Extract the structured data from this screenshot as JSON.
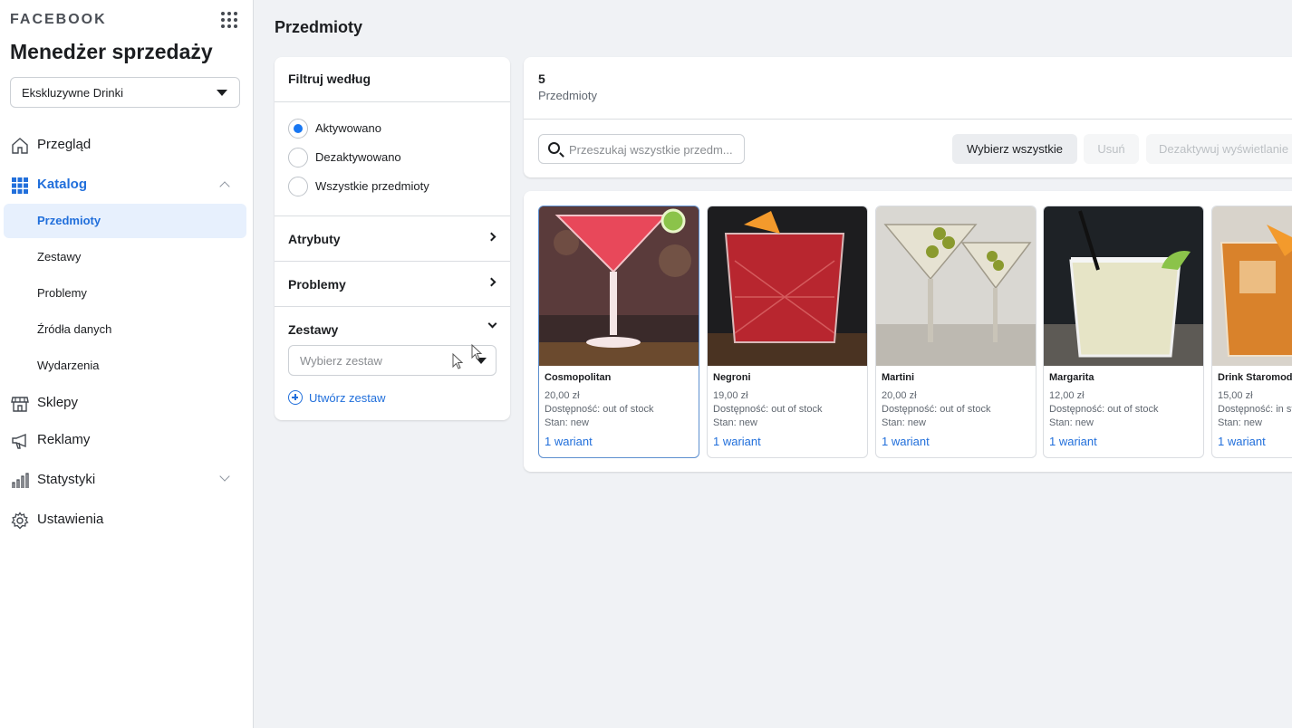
{
  "sidebar": {
    "brand": "FACEBOOK",
    "app_title": "Menedżer sprzedaży",
    "account": "Ekskluzywne Drinki",
    "nav": [
      {
        "label": "Przegląd",
        "icon": "home-icon"
      },
      {
        "label": "Katalog",
        "icon": "catalog-grid-icon"
      },
      {
        "label": "Sklepy",
        "icon": "shop-icon"
      },
      {
        "label": "Reklamy",
        "icon": "megaphone-icon"
      },
      {
        "label": "Statystyki",
        "icon": "bar-chart-icon"
      },
      {
        "label": "Ustawienia",
        "icon": "gear-icon"
      }
    ],
    "catalog_sub": [
      "Przedmioty",
      "Zestawy",
      "Problemy",
      "Źródła danych",
      "Wydarzenia"
    ]
  },
  "page": {
    "title": "Przedmioty"
  },
  "filter": {
    "header": "Filtruj według",
    "options": [
      "Aktywowano",
      "Dezaktywowano",
      "Wszystkie przedmioty"
    ],
    "selected": "Aktywowano",
    "sections": [
      "Atrybuty",
      "Problemy",
      "Zestawy"
    ],
    "set_placeholder": "Wybierz zestaw",
    "create_set": "Utwórz zestaw"
  },
  "items": {
    "count": "5",
    "count_label": "Przedmioty",
    "search_placeholder": "Przeszukaj wszystkie przedm...",
    "select_all": "Wybierz wszystkie",
    "delete": "Usuń",
    "deactivate": "Dezaktywuj wyświetlanie"
  },
  "products": [
    {
      "name": "Cosmopolitan",
      "price": "20,00 zł",
      "availability": "Dostępność: out of stock",
      "state": "Stan: new",
      "variants": "1 wariant"
    },
    {
      "name": "Negroni",
      "price": "19,00 zł",
      "availability": "Dostępność: out of stock",
      "state": "Stan: new",
      "variants": "1 wariant"
    },
    {
      "name": "Martini",
      "price": "20,00 zł",
      "availability": "Dostępność: out of stock",
      "state": "Stan: new",
      "variants": "1 wariant"
    },
    {
      "name": "Margarita",
      "price": "12,00 zł",
      "availability": "Dostępność: out of stock",
      "state": "Stan: new",
      "variants": "1 wariant"
    },
    {
      "name": "Drink Staromodny",
      "price": "15,00 zł",
      "availability": "Dostępność: in stock",
      "state": "Stan: new",
      "variants": "1 wariant"
    }
  ],
  "colors": {
    "accent": "#216fdb",
    "radio": "#1877f2",
    "selected_bg": "#e7f0fd"
  }
}
